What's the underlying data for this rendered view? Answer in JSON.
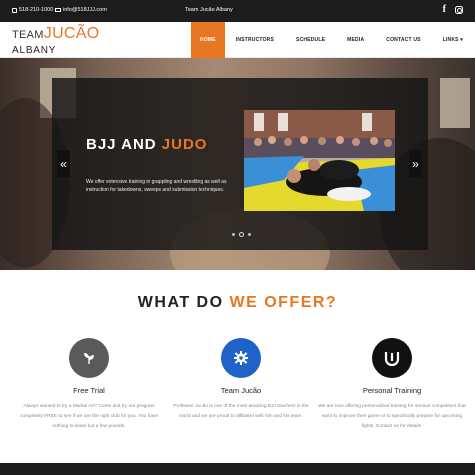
{
  "topbar": {
    "phone": "518-210-1000",
    "email": "info@518JJJ.com",
    "title": "Team Jucão Albany",
    "socials": [
      "facebook-icon",
      "instagram-icon"
    ]
  },
  "logo": {
    "team": "TEAM",
    "jucao": "JUCÃO",
    "albany": "ALBANY"
  },
  "nav": {
    "items": [
      "HOME",
      "INSTRUCTORS",
      "SCHEDULE",
      "MEDIA",
      "CONTACT US",
      "LINKS ▾"
    ],
    "active": "HOME"
  },
  "hero": {
    "title_plain": "BJJ AND ",
    "title_highlight": "JUDO",
    "text": "We offer extensive training in grappling and wrestling as well as instruction for takedowns, sweeps and submission techniques.",
    "prev_label": "«",
    "next_label": "»"
  },
  "offer": {
    "heading_plain": "WHAT DO ",
    "heading_highlight": "WE OFFER?",
    "features": [
      {
        "title": "Free Trial",
        "icon": "leaf-icon",
        "desc": "Always wanted to try a Martial Art? Come and try our program completely FREE to see if we are the right club for you. You have nothing to loose but a few pounds."
      },
      {
        "title": "Team Jucão",
        "icon": "gear-icon",
        "desc": "Professor Jucão is one of the most amazing BJJ teachers in the world and we are proud to affiliated with him and his team."
      },
      {
        "title": "Personal Training",
        "icon": "uj-logo-icon",
        "desc": "We are now offering personalized training for serious competitors that want to improve their game or to specifically prepare for upcoming fights. Contact us for details."
      }
    ]
  },
  "colors": {
    "accent": "#e87722",
    "topbar": "#1c1c1c",
    "feature1": "#5a5a5a",
    "feature2": "#1f63c9",
    "feature3": "#111111"
  }
}
